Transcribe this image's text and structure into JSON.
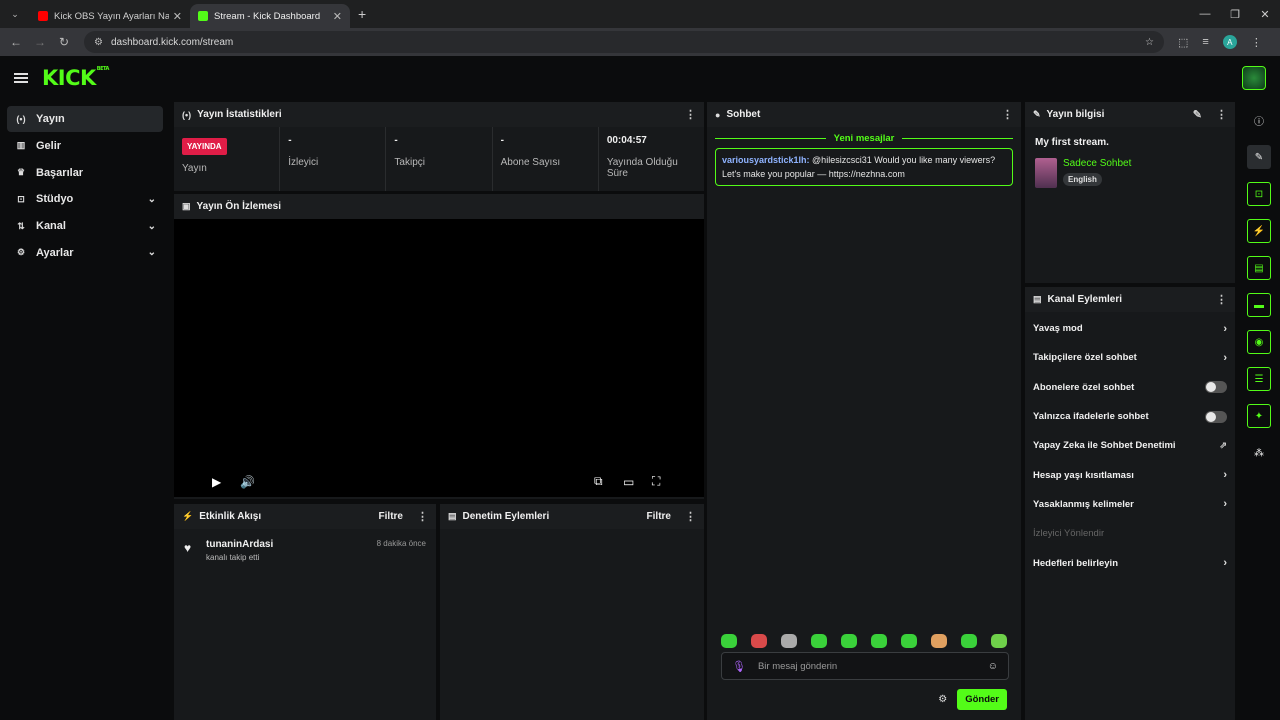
{
  "browser": {
    "tabs": [
      {
        "title": "Kick OBS Yayın Ayarları Nasıl Yapılır",
        "favicon_color": "#ff0000",
        "active": false
      },
      {
        "title": "Stream - Kick Dashboard",
        "favicon_color": "#53fc18",
        "active": true
      }
    ],
    "url": "dashboard.kick.com/stream",
    "account_initial": "A"
  },
  "brand": {
    "logo": "KICK",
    "beta": "BETA",
    "accent": "#53fc18"
  },
  "sidebar": {
    "items": [
      {
        "label": "Yayın",
        "icon": "broadcast-icon",
        "glyph": "(•)",
        "active": true,
        "expandable": false
      },
      {
        "label": "Gelir",
        "icon": "revenue-icon",
        "glyph": "▥",
        "active": false,
        "expandable": false
      },
      {
        "label": "Başarılar",
        "icon": "trophy-icon",
        "glyph": "🏆",
        "active": false,
        "expandable": false
      },
      {
        "label": "Stüdyo",
        "icon": "studio-icon",
        "glyph": "⊡",
        "active": false,
        "expandable": true
      },
      {
        "label": "Kanal",
        "icon": "channel-icon",
        "glyph": "⇅",
        "active": false,
        "expandable": true
      },
      {
        "label": "Ayarlar",
        "icon": "gear-icon",
        "glyph": "⚙",
        "active": false,
        "expandable": true
      }
    ]
  },
  "stats": {
    "title": "Yayın İstatistikleri",
    "live_badge": "YAYINDA",
    "cells": [
      {
        "value": "",
        "label": "Yayın"
      },
      {
        "value": "-",
        "label": "İzleyici"
      },
      {
        "value": "-",
        "label": "Takipçi"
      },
      {
        "value": "-",
        "label": "Abone Sayısı"
      },
      {
        "value": "00:04:57",
        "label": "Yayında Olduğu Süre"
      }
    ]
  },
  "preview": {
    "title": "Yayın Ön İzlemesi"
  },
  "activity": {
    "title": "Etkinlik Akışı",
    "filter": "Filtre",
    "items": [
      {
        "name": "tunaninArdasi",
        "action": "kanalı takip etti",
        "time": "8 dakika önce"
      }
    ]
  },
  "moderation": {
    "title": "Denetim Eylemleri",
    "filter": "Filtre"
  },
  "chat": {
    "title": "Sohbet",
    "new_messages": "Yeni mesajlar",
    "messages": [
      {
        "user": "variousyardstick1lh:",
        "text": " @hilesizcsci31 Would you like many viewers? Let's make you popular — https://nezhna.com"
      }
    ],
    "input_placeholder": "Bir mesaj gönderin",
    "send_label": "Gönder"
  },
  "stream_info": {
    "title": "Yayın bilgisi",
    "stream_title": "My first stream.",
    "category": "Sadece Sohbet",
    "language": "English"
  },
  "channel_actions": {
    "title": "Kanal Eylemleri",
    "items": [
      {
        "label": "Yavaş mod",
        "control": "chevron"
      },
      {
        "label": "Takipçilere özel sohbet",
        "control": "chevron"
      },
      {
        "label": "Abonelere özel sohbet",
        "control": "toggle"
      },
      {
        "label": "Yalnızca ifadelerle sohbet",
        "control": "toggle"
      },
      {
        "label": "Yapay Zeka ile Sohbet Denetimi",
        "control": "external"
      },
      {
        "label": "Hesap yaşı kısıtlaması",
        "control": "chevron"
      },
      {
        "label": "Yasaklanmış kelimeler",
        "control": "chevron"
      },
      {
        "label": "İzleyici Yönlendir",
        "control": "disabled"
      },
      {
        "label": "Hedefleri belirleyin",
        "control": "chevron"
      }
    ]
  }
}
